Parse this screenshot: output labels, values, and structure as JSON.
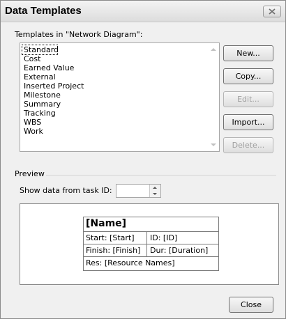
{
  "dialog": {
    "title": "Data Templates"
  },
  "templates_label": "Templates in \"Network Diagram\":",
  "templates": [
    "Standard",
    "Cost",
    "Earned Value",
    "External",
    "Inserted Project",
    "Milestone",
    "Summary",
    "Tracking",
    "WBS",
    "Work"
  ],
  "selected_template": "Standard",
  "buttons": {
    "new": "New...",
    "copy": "Copy...",
    "edit": "Edit...",
    "import": "Import...",
    "delete": "Delete...",
    "close": "Close"
  },
  "preview": {
    "section_label": "Preview",
    "show_data_label": "Show data from task ID:",
    "task_id_value": "",
    "card": {
      "name": "[Name]",
      "start": "Start:  [Start]",
      "id": "ID:  [ID]",
      "finish": "Finish: [Finish]",
      "dur": "Dur: [Duration]",
      "res": "Res:   [Resource Names]"
    }
  },
  "icons": [
    "close-icon",
    "scroll-up-icon",
    "scroll-down-icon",
    "spin-up-icon",
    "spin-down-icon"
  ]
}
